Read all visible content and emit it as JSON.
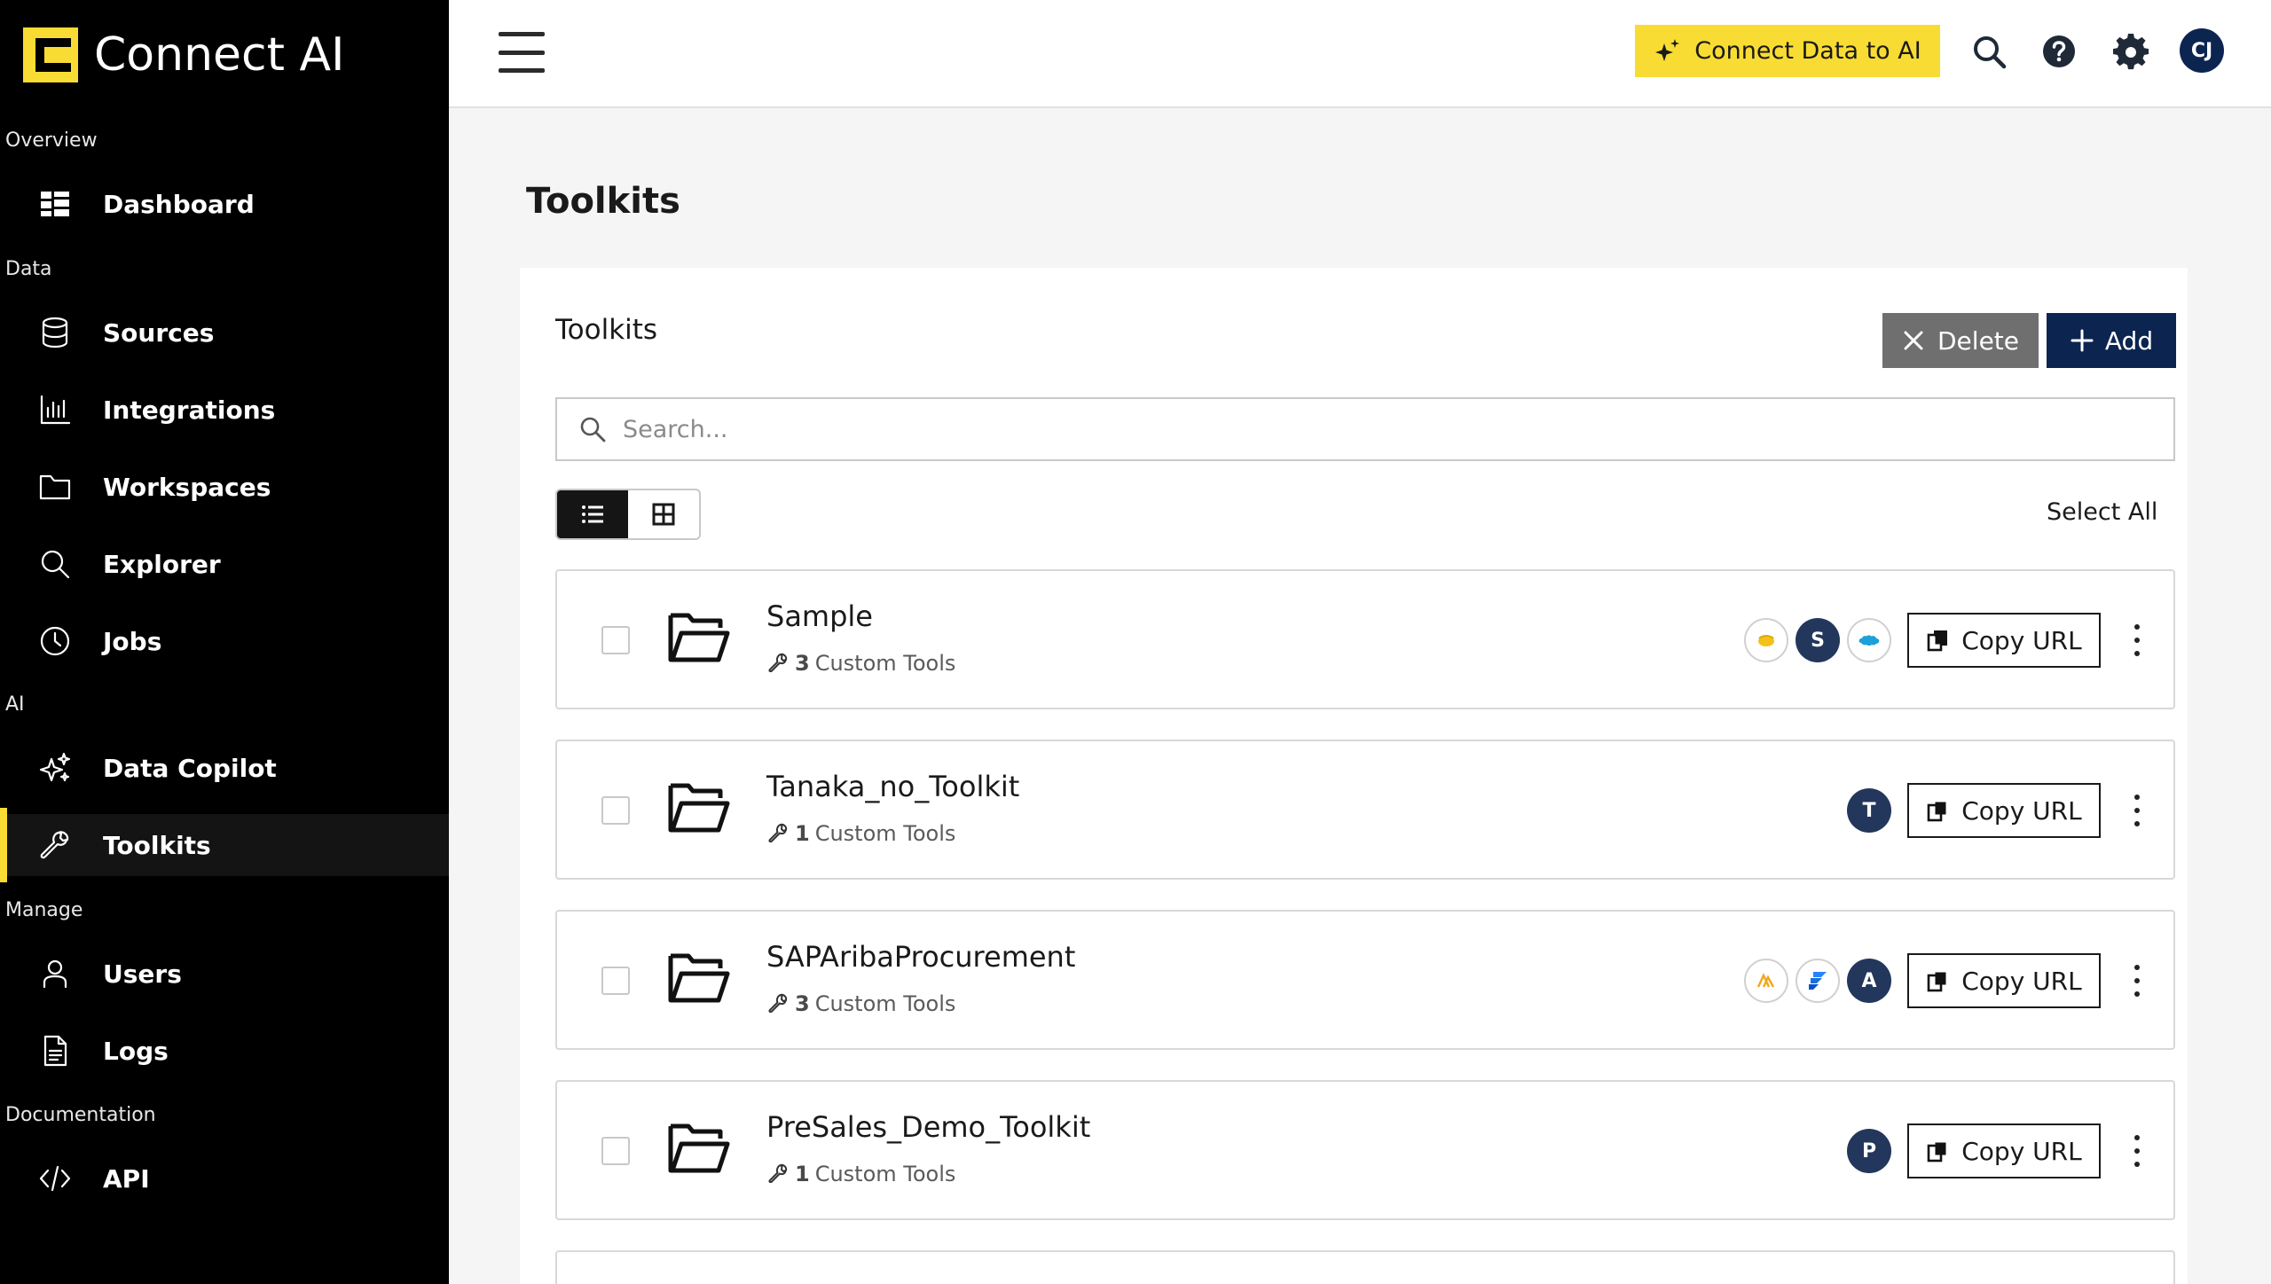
{
  "app": {
    "brand": "Connect AI"
  },
  "sidebar": {
    "sections": [
      {
        "label": "Overview",
        "items": [
          {
            "label": "Dashboard",
            "icon": "dashboard-icon"
          }
        ]
      },
      {
        "label": "Data",
        "items": [
          {
            "label": "Sources",
            "icon": "database-icon"
          },
          {
            "label": "Integrations",
            "icon": "bar-chart-icon"
          },
          {
            "label": "Workspaces",
            "icon": "folder-icon"
          },
          {
            "label": "Explorer",
            "icon": "search-icon"
          },
          {
            "label": "Jobs",
            "icon": "clock-icon"
          }
        ]
      },
      {
        "label": "AI",
        "items": [
          {
            "label": "Data Copilot",
            "icon": "sparkle-icon"
          },
          {
            "label": "Toolkits",
            "icon": "wrench-icon",
            "active": true
          }
        ]
      },
      {
        "label": "Manage",
        "items": [
          {
            "label": "Users",
            "icon": "user-icon"
          },
          {
            "label": "Logs",
            "icon": "document-icon"
          }
        ]
      },
      {
        "label": "Documentation",
        "items": [
          {
            "label": "API",
            "icon": "code-icon"
          }
        ]
      }
    ]
  },
  "topbar": {
    "cta_label": "Connect Data to AI",
    "user_initials": "CJ",
    "accent": "#f8dc33",
    "navy": "#0c2550"
  },
  "main": {
    "page_title": "Toolkits",
    "panel_title": "Toolkits",
    "delete_label": "Delete",
    "add_label": "Add",
    "search_placeholder": "Search...",
    "select_all_label": "Select All",
    "copy_url_label": "Copy URL",
    "custom_tools_suffix": "Custom Tools",
    "toolkits": [
      {
        "name": "Sample",
        "tool_count": "3",
        "chips": [
          "logo-yellow",
          "S",
          "logo-salesforce"
        ]
      },
      {
        "name": "Tanaka_no_Toolkit",
        "tool_count": "1",
        "chips": [
          "T"
        ]
      },
      {
        "name": "SAPAribaProcurement",
        "tool_count": "3",
        "chips": [
          "logo-ariba",
          "logo-jira",
          "A"
        ]
      },
      {
        "name": "PreSales_Demo_Toolkit",
        "tool_count": "1",
        "chips": [
          "P"
        ]
      }
    ]
  }
}
